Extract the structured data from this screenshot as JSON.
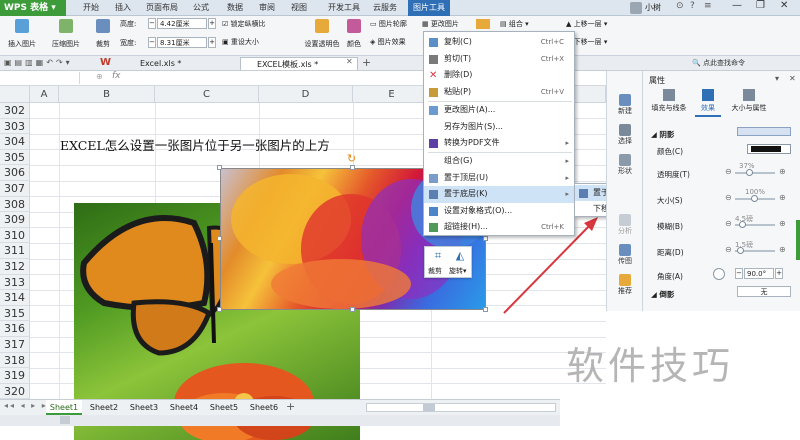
{
  "app": {
    "title": "WPS 表格",
    "user": "小树"
  },
  "ribbon_tabs": [
    "开始",
    "插入",
    "页面布局",
    "公式",
    "数据",
    "审阅",
    "视图",
    "开发工具",
    "云服务",
    "图片工具"
  ],
  "active_tab": "图片工具",
  "ribbon": {
    "insert_picture": "插入图片",
    "compress": "压缩图片",
    "crop": "裁剪",
    "height_label": "高度:",
    "height_value": "4.42厘米",
    "width_label": "宽度:",
    "width_value": "8.31厘米",
    "lock_ratio": "锁定纵横比",
    "reset_size": "重设大小",
    "set_transparent": "设置透明色",
    "color": "颜色",
    "outline": "图片轮廓",
    "effect": "图片效果",
    "change_picture": "更改图片",
    "combine": "组合",
    "bring_forward": "上移一层",
    "send_backward": "下移一层"
  },
  "doc_tabs": [
    "Excel.xls *",
    "EXCEL模板.xls *"
  ],
  "formula_bar": {
    "cell_ref": "",
    "fx": "fx"
  },
  "columns": [
    "A",
    "B",
    "C",
    "D",
    "E"
  ],
  "rows": [
    "302",
    "303",
    "304",
    "305",
    "306",
    "307",
    "308",
    "309",
    "310",
    "311",
    "312",
    "313",
    "314",
    "315",
    "316",
    "317",
    "318",
    "319",
    "320"
  ],
  "cell_text": "EXCEL怎么设置一张图片位于另一张图片的上方",
  "context_menu": [
    {
      "label": "复制(C)",
      "shortcut": "Ctrl+C"
    },
    {
      "label": "剪切(T)",
      "shortcut": "Ctrl+X"
    },
    {
      "label": "删除(D)",
      "shortcut": ""
    },
    {
      "label": "粘贴(P)",
      "shortcut": "Ctrl+V"
    },
    {
      "label": "更改图片(A)...",
      "shortcut": ""
    },
    {
      "label": "另存为图片(S)...",
      "shortcut": ""
    },
    {
      "label": "转换为PDF文件",
      "shortcut": ""
    },
    {
      "label": "组合(G)",
      "shortcut": ""
    },
    {
      "label": "置于顶层(U)",
      "shortcut": ""
    },
    {
      "label": "置于底层(K)",
      "shortcut": ""
    },
    {
      "label": "设置对象格式(O)...",
      "shortcut": ""
    },
    {
      "label": "超链接(H)...",
      "shortcut": "Ctrl+K"
    }
  ],
  "submenu": [
    {
      "label": "置于底层(K)"
    },
    {
      "label": "下移一层(B)"
    }
  ],
  "float_toolbar": {
    "crop": "裁剪",
    "rotate": "旋转"
  },
  "side_buttons": [
    "新建",
    "选择",
    "形状",
    "分析",
    "传图",
    "推荐"
  ],
  "properties": {
    "title": "属性",
    "tabs": [
      "填充与线条",
      "效果",
      "大小与属性"
    ],
    "shadow": "阴影",
    "color": "颜色(C)",
    "transparency": "透明度(T)",
    "transparency_value": "37%",
    "size": "大小(S)",
    "size_value": "100%",
    "blur": "模糊(B)",
    "blur_value": "4.5磅",
    "distance": "距离(D)",
    "distance_value": "1.5磅",
    "angle": "角度(A)",
    "angle_value": "90.0°",
    "reflection": "倒影",
    "reflection_value": "无",
    "topright": "点此查找命令"
  },
  "sheet_tabs": [
    "Sheet1",
    "Sheet2",
    "Sheet3",
    "Sheet4",
    "Sheet5",
    "Sheet6"
  ],
  "active_sheet": "Sheet1",
  "watermark": "软件技巧",
  "colors": {
    "accent": "#2f6fb5",
    "green": "#3e9b3a",
    "highlight": "#cfe3f7",
    "arrow": "#d9363e"
  }
}
